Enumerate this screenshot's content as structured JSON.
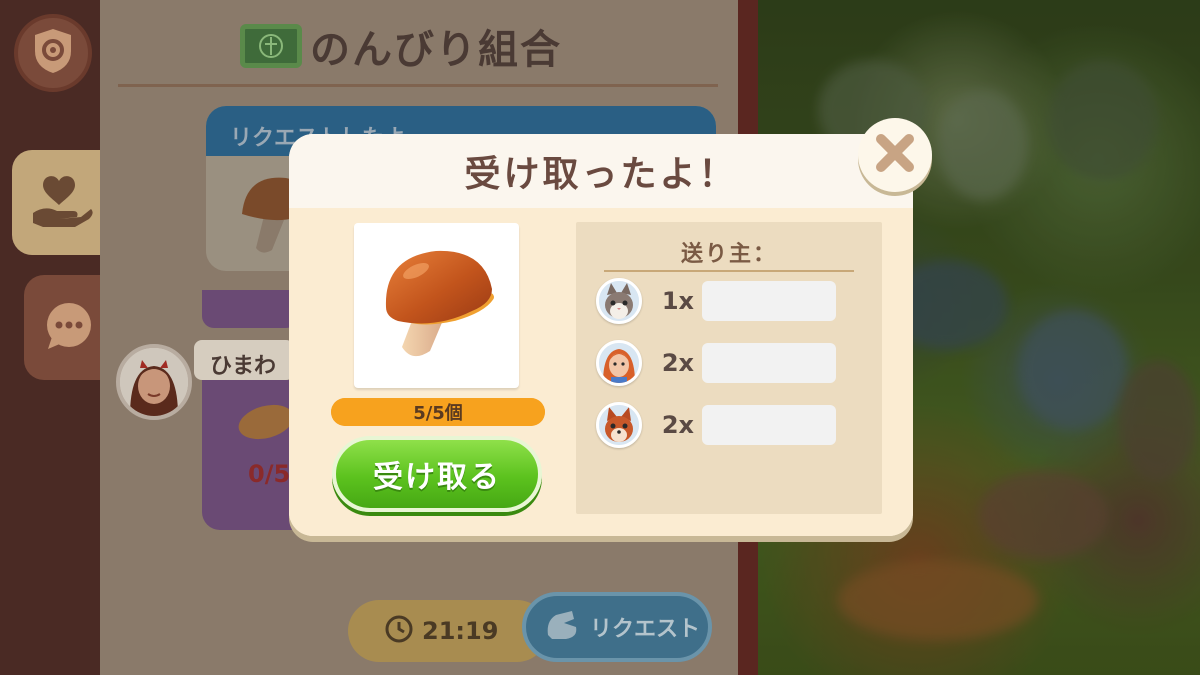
{
  "background_panel": {
    "title": "のんびり組合",
    "request_card_header": "リクエストしたよ",
    "member_name": "ひまわ",
    "bread_progress": "0/5",
    "timer": "21:19",
    "request_button_label": "リクエスト"
  },
  "icons": {
    "settings": "gear-shield-icon",
    "help": "heart-hand-icon",
    "chat": "chat-bubble-icon",
    "close": "close-icon",
    "clock": "clock-icon",
    "request": "request-icon"
  },
  "modal": {
    "title": "受け取ったよ！",
    "item": "mushroom",
    "progress_text": "5/5個",
    "progress_fraction": 1.0,
    "receive_button_label": "受け取る",
    "sender_title": "送り主：",
    "senders": [
      {
        "avatar": "cat-avatar",
        "count": "1x"
      },
      {
        "avatar": "girl-avatar",
        "count": "2x"
      },
      {
        "avatar": "squirrel-avatar",
        "count": "2x"
      }
    ]
  },
  "colors": {
    "receive_button": "#5cc21e",
    "progress_bar": "#f59a1e",
    "modal_bg": "#fdf7ea",
    "modal_body": "#fbecd2"
  }
}
